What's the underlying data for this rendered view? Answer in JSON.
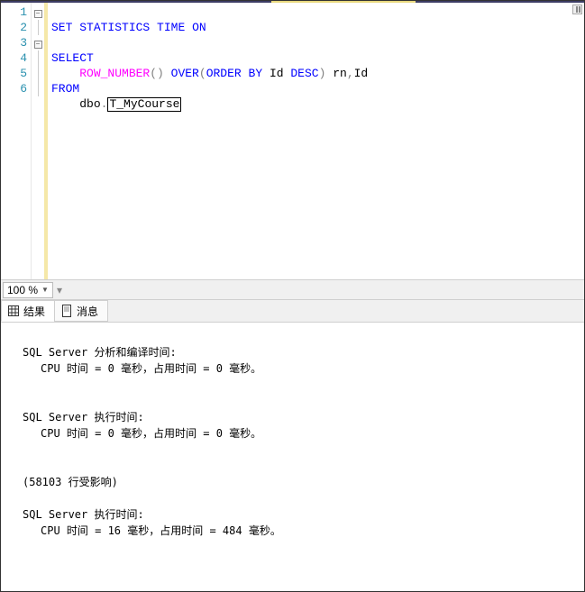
{
  "code": {
    "line_numbers": [
      "1",
      "2",
      "3",
      "4",
      "5",
      "6"
    ],
    "l1_set": "SET",
    "l1_stat": "STATISTICS",
    "l1_time": "TIME",
    "l1_on": "ON",
    "l3_select": "SELECT",
    "l4_fn": "ROW_NUMBER",
    "l4_over": "OVER",
    "l4_order": "ORDER",
    "l4_by": "BY",
    "l4_id": "Id",
    "l4_desc": "DESC",
    "l4_alias": "rn",
    "l4_id2": "Id",
    "l5_from": "FROM",
    "l6_schema": "dbo",
    "l6_table": "T_MyCourse"
  },
  "zoom": {
    "value": "100 %"
  },
  "tabs": {
    "results": "结果",
    "messages": "消息"
  },
  "output": {
    "parse_label": "SQL Server 分析和编译时间:",
    "parse_detail": "CPU 时间 = 0 毫秒，占用时间 = 0 毫秒。",
    "exec1_label": "SQL Server 执行时间:",
    "exec1_detail": "CPU 时间 = 0 毫秒，占用时间 = 0 毫秒。",
    "rows": "(58103 行受影响)",
    "exec2_label": "SQL Server 执行时间:",
    "exec2_detail": "CPU 时间 = 16 毫秒，占用时间 = 484 毫秒。"
  }
}
